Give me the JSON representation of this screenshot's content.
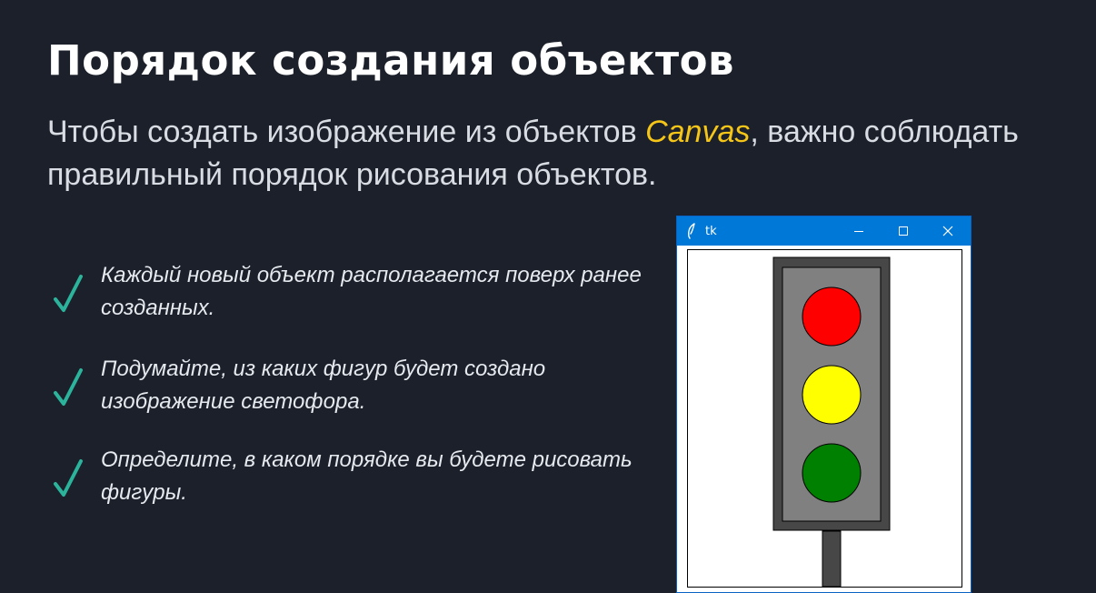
{
  "slide": {
    "title": "Порядок создания объектов",
    "subtitle_before": "Чтобы создать изображение из объектов ",
    "subtitle_accent": "Canvas",
    "subtitle_after": ", важно соблюдать правильный порядок рисования объектов.",
    "accent_color": "#f5c518",
    "background_color": "#1b202b"
  },
  "bullets": [
    {
      "icon": "check-icon",
      "text": "Каждый новый объект располагается поверх ранее созданных."
    },
    {
      "icon": "check-icon",
      "text": "Подумайте, из каких фигур будет создано изображение светофора."
    },
    {
      "icon": "check-icon",
      "text": "Определите, в каком порядке вы будете рисовать фигуры."
    }
  ],
  "check_color": "#2bb39b",
  "tk_window": {
    "title": "tk",
    "titlebar_color": "#0078d7",
    "controls": [
      "minimize-icon",
      "maximize-icon",
      "close-icon"
    ],
    "traffic_light": {
      "housing_color": "#474747",
      "panel_color": "#808080",
      "lights": [
        "#ff0000",
        "#ffff00",
        "#008000"
      ]
    }
  }
}
